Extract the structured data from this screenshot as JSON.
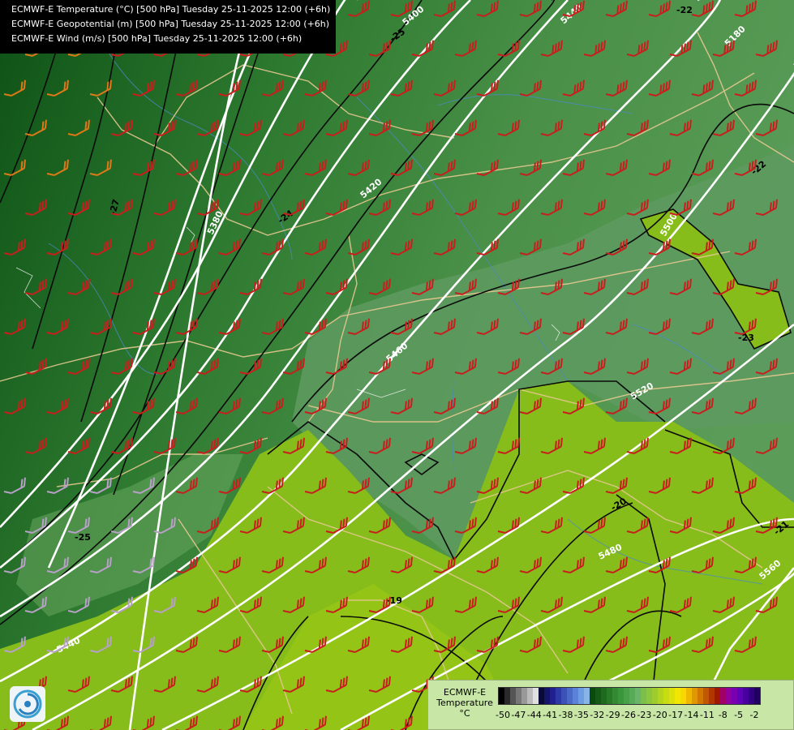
{
  "header": {
    "lines": [
      "ECMWF-E Temperature (°C) [500 hPa] Tuesday 25-11-2025 12:00 (+6h)",
      "ECMWF-E Geopotential (m) [500 hPa] Tuesday 25-11-2025 12:00 (+6h)",
      "ECMWF-E Wind (m/s) [500 hPa] Tuesday 25-11-2025 12:00 (+6h)"
    ]
  },
  "legend": {
    "line1": "ECMWF-E",
    "line2": "Temperature",
    "line3": "°C",
    "ticks": [
      "-50",
      "-47",
      "-44",
      "-41",
      "-38",
      "-35",
      "-32",
      "-29",
      "-26",
      "-23",
      "-20",
      "-17",
      "-14",
      "-11",
      "-8",
      "-5",
      "-2"
    ],
    "colors": [
      "#000000",
      "#2a2a2a",
      "#555555",
      "#777777",
      "#999999",
      "#bbbbbb",
      "#e0e0e0",
      "#0a0a3a",
      "#15156a",
      "#202090",
      "#2c3aa8",
      "#3c52b8",
      "#4a6ac8",
      "#5a82d8",
      "#6e9ce0",
      "#88b4e8",
      "#0a4a0a",
      "#145a14",
      "#1e6a1e",
      "#287a28",
      "#328a32",
      "#3c963c",
      "#48a048",
      "#58aa58",
      "#6ab46a",
      "#7cbe4c",
      "#8cc63c",
      "#9ecc2c",
      "#b4d41e",
      "#c8dc14",
      "#dce00c",
      "#f0e800",
      "#f8d800",
      "#f0b800",
      "#e09800",
      "#d07800",
      "#c05800",
      "#b03800",
      "#a01800",
      "#a0006a",
      "#9000a0",
      "#7800b0",
      "#6000b8",
      "#4800a0",
      "#300080",
      "#200060"
    ]
  },
  "contours": {
    "geopotential": [
      "5400",
      "5440",
      "5420",
      "5380",
      "5460",
      "5500",
      "5520",
      "5560",
      "5440",
      "5480",
      "5180"
    ],
    "temperature": [
      "-25",
      "-27",
      "-24",
      "-22",
      "-23",
      "-19",
      "-20",
      "-21",
      "-22",
      "-25",
      "-17"
    ]
  },
  "colors": {
    "dark_green": "#1d5e24",
    "mid_green": "#3f8a42",
    "gray_green": "#5f9a5f",
    "yellow_green": "#8ac218",
    "border": "#e6c890",
    "river": "#4a8ac8",
    "wind_barb": "#c81e1e"
  }
}
